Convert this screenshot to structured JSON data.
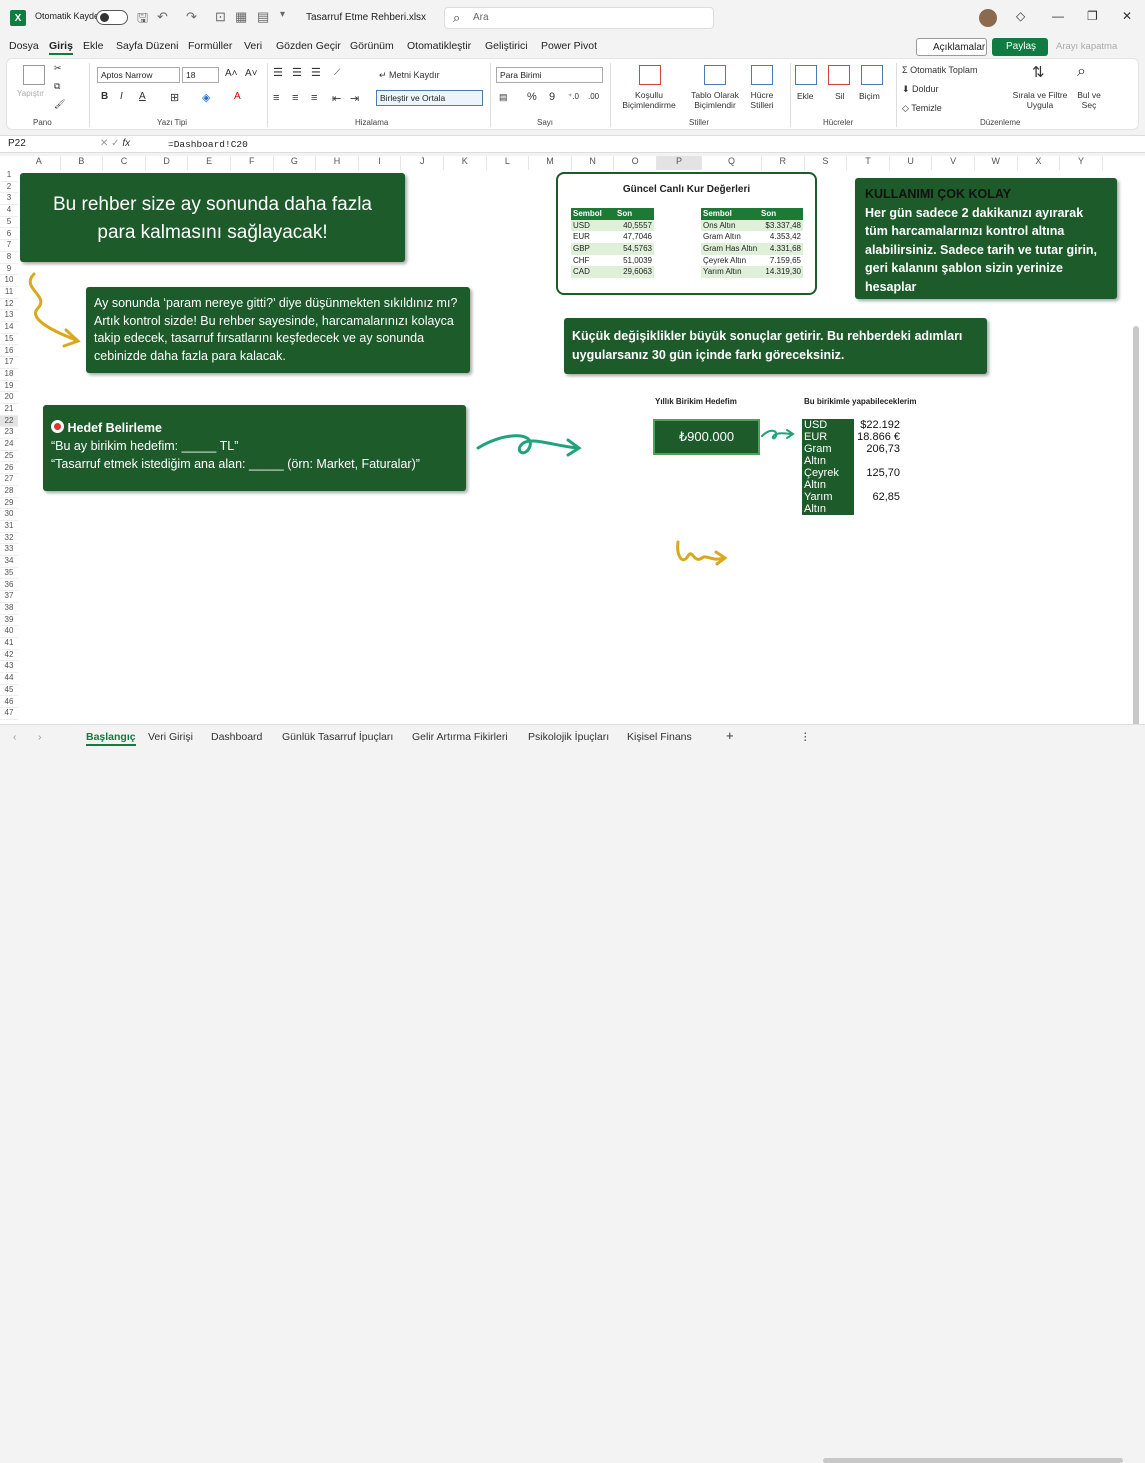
{
  "window": {
    "autosave_label": "Otomatik Kaydet",
    "file_title": "Tasarruf Etme Rehberi.xlsx",
    "search_placeholder": "Ara"
  },
  "menu": [
    "Dosya",
    "Giriş",
    "Ekle",
    "Sayfa Düzeni",
    "Formüller",
    "Veri",
    "Gözden Geçir",
    "Görünüm",
    "Otomatikleştir",
    "Geliştirici",
    "Power Pivot"
  ],
  "actions": {
    "comments": "Açıklamalar",
    "share": "Paylaş",
    "close_search": "Arayı kapatma"
  },
  "ribbon": {
    "paste": "Yapıştır",
    "font_name": "Aptos Narrow",
    "font_size": "18",
    "wrap_text": "Metni Kaydır",
    "merge_center": "Birleştir ve Ortala",
    "number_format": "Para Birimi",
    "cond_format": "Koşullu Biçimlendirme",
    "format_table": "Tablo Olarak Biçimlendir",
    "cell_styles": "Hücre Stilleri",
    "insert": "Ekle",
    "delete": "Sil",
    "format": "Biçim",
    "autosum": "Otomatik Toplam",
    "fill": "Doldur",
    "clear": "Temizle",
    "sort_filter": "Sırala ve Filtre Uygula",
    "find_select": "Bul ve Seç",
    "groups": [
      "Pano",
      "Yazı Tipi",
      "Hizalama",
      "Sayı",
      "Stiller",
      "Hücreler",
      "Düzenleme"
    ]
  },
  "formula_bar": {
    "cell_ref": "P22",
    "formula": "=Dashboard!C20"
  },
  "columns": [
    "A",
    "B",
    "C",
    "D",
    "E",
    "F",
    "G",
    "H",
    "I",
    "J",
    "K",
    "L",
    "M",
    "N",
    "O",
    "P",
    "Q",
    "R",
    "S",
    "T",
    "U",
    "V",
    "W",
    "X",
    "Y"
  ],
  "rows": [
    "1",
    "2",
    "3",
    "4",
    "5",
    "6",
    "7",
    "8",
    "9",
    "10",
    "11",
    "12",
    "13",
    "14",
    "15",
    "16",
    "17",
    "18",
    "19",
    "20",
    "21",
    "22",
    "23",
    "24",
    "25",
    "26",
    "27",
    "28",
    "29",
    "30",
    "31",
    "32",
    "33",
    "34",
    "35",
    "36",
    "37",
    "38",
    "39",
    "40",
    "41",
    "42",
    "43",
    "44",
    "45",
    "46",
    "47"
  ],
  "cards": {
    "headline": "Bu rehber size ay sonunda daha fazla para kalmasını sağlayacak!",
    "intro": "Ay sonunda ‘param nereye gitti?’ diye düşünmekten sıkıldınız mı? Artık kontrol sizde! Bu rehber sayesinde, harcamalarınızı kolayca takip edecek, tasarruf fırsatlarını keşfedecek ve ay sonunda cebinizde daha fazla para kalacak.",
    "easy_title": "KULLANIMI ÇOK KOLAY",
    "easy_body": "Her gün sadece 2 dakikanızı ayırarak tüm harcamalarınızı kontrol altına alabilirsiniz. Sadece tarih ve tutar girin, geri kalanını şablon sizin yerinize hesaplar",
    "small_changes": "Küçük değişiklikler büyük sonuçlar getirir. Bu rehberdeki adımları uygularsanız 30 gün içinde farkı göreceksiniz.",
    "goal_title": "Hedef Belirleme",
    "goal_line1": "“Bu ay birikim hedefim: _____ TL”",
    "goal_line2": "“Tasarruf etmek istediğim ana alan: _____ (örn: Market, Faturalar)”"
  },
  "rates": {
    "title": "Güncel Canlı Kur Değerleri",
    "headers": [
      "Sembol",
      "Son"
    ],
    "currencies": [
      [
        "USD",
        "40,5557"
      ],
      [
        "EUR",
        "47,7046"
      ],
      [
        "GBP",
        "54,5763"
      ],
      [
        "CHF",
        "51,0039"
      ],
      [
        "CAD",
        "29,6063"
      ]
    ],
    "gold": [
      [
        "Ons Altın",
        "$3.337,48"
      ],
      [
        "Gram Altın",
        "4.353,42"
      ],
      [
        "Gram Has Altın",
        "4.331,68"
      ],
      [
        "Çeyrek Altın",
        "7.159,65"
      ],
      [
        "Yarım Altın",
        "14.319,30"
      ]
    ]
  },
  "savings": {
    "goal_label": "Yıllık Birikim Hedefim",
    "goal_value": "₺900.000",
    "can_do_label": "Bu birikimle yapabileceklerim",
    "items": [
      [
        "USD",
        "$22.192"
      ],
      [
        "EUR",
        "18.866 €"
      ],
      [
        "Gram Altın",
        "206,73"
      ],
      [
        "Çeyrek Altın",
        "125,70"
      ],
      [
        "Yarım Altın",
        "62,85"
      ]
    ]
  },
  "sheet_tabs": [
    "Başlangıç",
    "Veri Girişi",
    "Dashboard",
    "Günlük Tasarruf İpuçları",
    "Gelir Artırma Fikirleri",
    "Psikolojik İpuçları",
    "Kişisel Finans"
  ]
}
